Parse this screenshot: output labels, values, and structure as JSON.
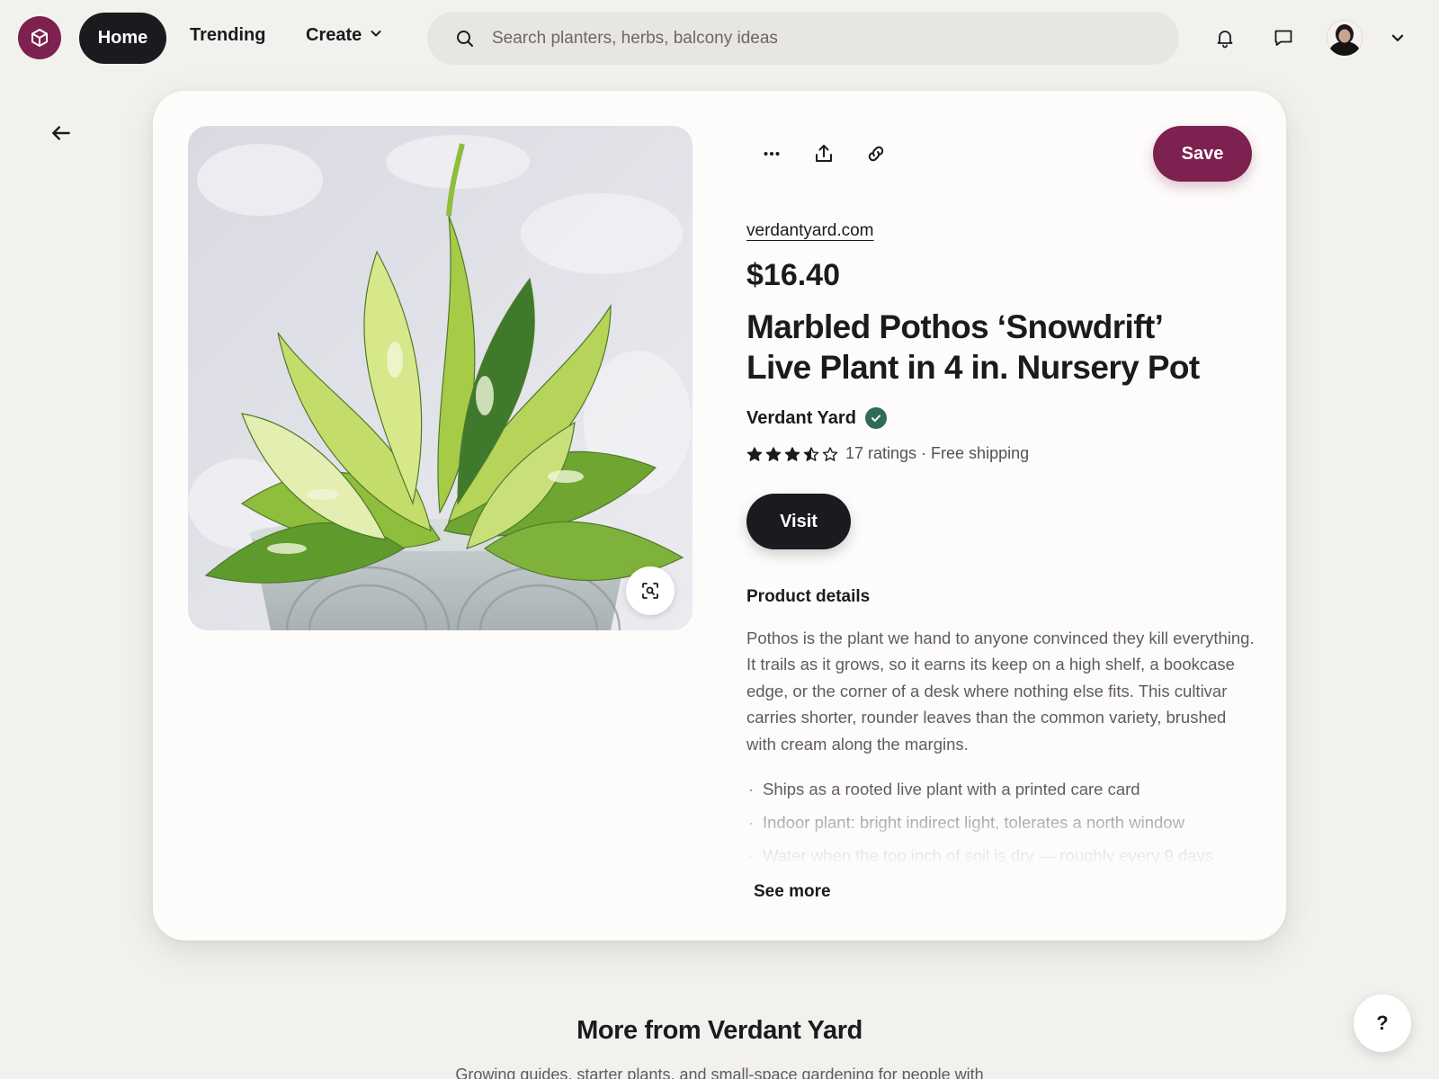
{
  "nav": {
    "home_label": "Home",
    "trending_label": "Trending",
    "create_label": "Create"
  },
  "search": {
    "placeholder": "Search planters, herbs, balcony ideas",
    "value": ""
  },
  "icons": {
    "logo": "cube-logo-icon",
    "search": "search-icon",
    "notifications": "bell-icon",
    "messages": "chat-bubble-icon",
    "account_menu": "chevron-down-icon",
    "back": "arrow-left-icon",
    "more": "ellipsis-icon",
    "share": "share-icon",
    "copy_link": "link-icon",
    "visual_search": "lens-icon",
    "verified": "check-badge-icon"
  },
  "colors": {
    "brand": "#7d2150",
    "dark_button": "#1c1a1e",
    "verified_badge": "#2f6b57",
    "page_background": "#f2f1ee",
    "card_background": "#fdfcfa"
  },
  "product": {
    "domain": "verdantyard.com",
    "price": "$16.40",
    "title": "Marbled Pothos ‘Snowdrift’ Live Plant in 4 in. Nursery Pot",
    "seller": "Verdant Yard",
    "rating": 3.5,
    "rating_max": 5,
    "ratings_text": "17 ratings · Free shipping",
    "save_label": "Save",
    "visit_label": "Visit",
    "details_heading": "Product details",
    "details_text": "Pothos is the plant we hand to anyone convinced they kill everything. It trails as it grows, so it earns its keep on a high shelf, a bookcase edge, or the corner of a desk where nothing else fits. This cultivar carries shorter, rounder leaves than the common variety, brushed with cream along the margins.",
    "bullets": [
      "Ships as a rooted live plant with a printed care card",
      "Indoor plant: bright indirect light, tolerates a north window",
      "Water when the top inch of soil is dry — roughly every 9 days"
    ],
    "see_more_label": "See more"
  },
  "more_from": {
    "title": "More from Verdant Yard",
    "subtitle": "Growing guides, starter plants, and small-space gardening for people with"
  },
  "help_label": "?"
}
